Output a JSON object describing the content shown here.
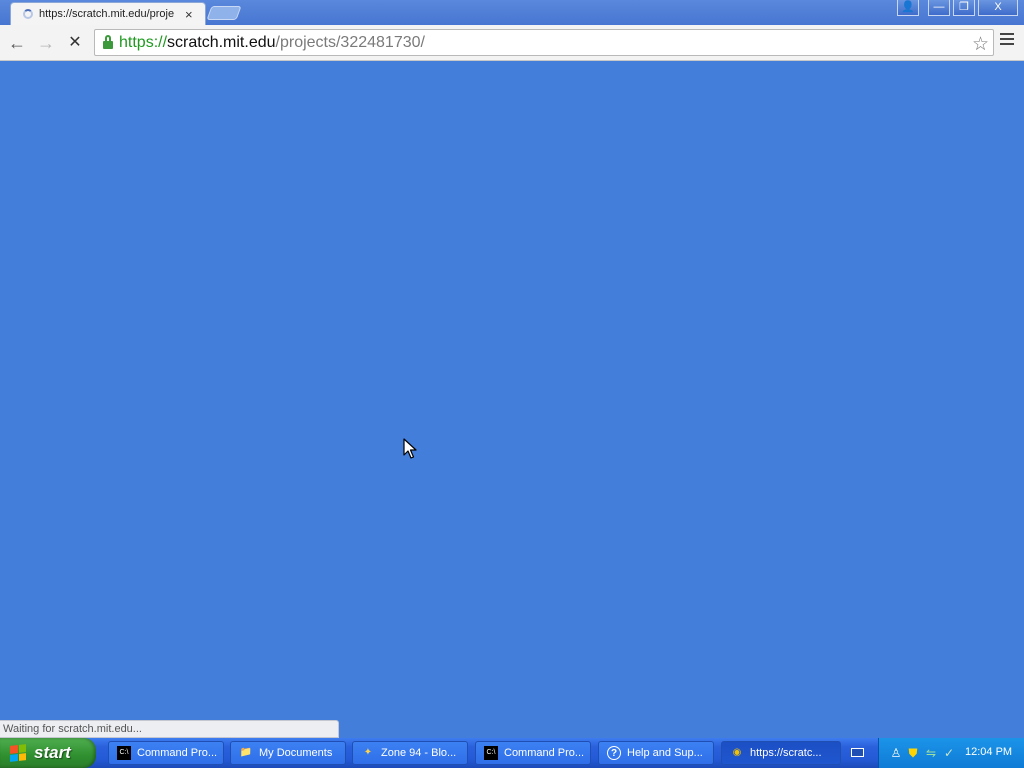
{
  "browser": {
    "tab": {
      "title": "https://scratch.mit.edu/proje",
      "close": "×"
    },
    "window_controls": [
      "👤",
      "—",
      "❐",
      "X"
    ],
    "toolbar": {
      "back": "←",
      "forward": "→",
      "stop": "✕"
    },
    "address": {
      "scheme": "https://",
      "host": "scratch.mit.edu",
      "path": "/projects/322481730/"
    },
    "bookmark_star": "☆",
    "status": "Waiting for scratch.mit.edu..."
  },
  "page": {
    "background": "#437fda"
  },
  "taskbar": {
    "start_label": "start",
    "items": [
      {
        "label": "Command Pro...",
        "icon": "C:\\"
      },
      {
        "label": "My Documents",
        "icon": "📁"
      },
      {
        "label": "Zone 94 - Blo...",
        "icon": "✦"
      },
      {
        "label": "Command Pro...",
        "icon": "C:\\"
      },
      {
        "label": "Help and Sup...",
        "icon": "?"
      },
      {
        "label": "https://scratc...",
        "icon": "◉"
      }
    ],
    "clock": "12:04 PM"
  }
}
